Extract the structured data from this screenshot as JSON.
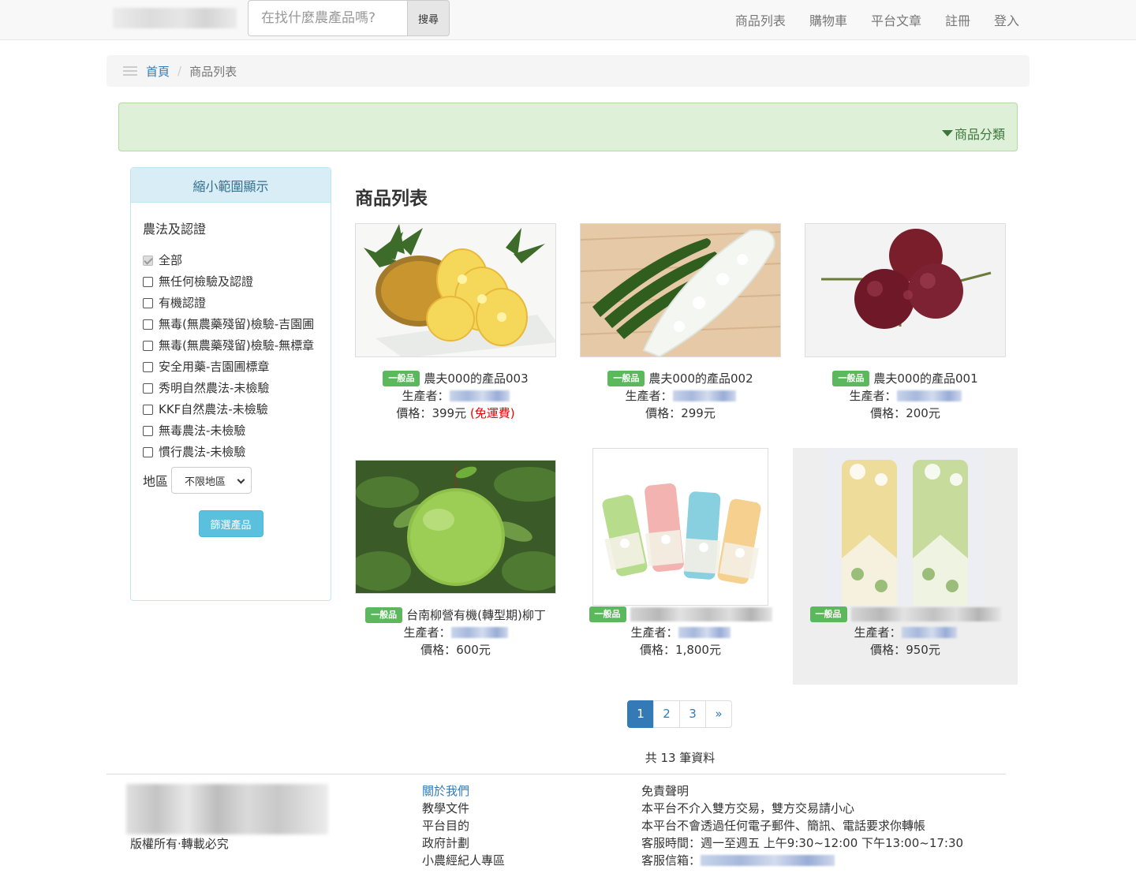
{
  "navbar": {
    "search_placeholder": "在找什麼農產品嗎?",
    "search_button": "搜尋",
    "links": [
      "商品列表",
      "購物車",
      "平台文章",
      "註冊",
      "登入"
    ]
  },
  "breadcrumb": {
    "home": "首頁",
    "separator": "/",
    "current": "商品列表"
  },
  "category_toggle": "商品分類",
  "filter": {
    "heading": "縮小範圍顯示",
    "section_title": "農法及認證",
    "options": [
      {
        "label": "全部",
        "checked": true
      },
      {
        "label": "無任何檢驗及認證",
        "checked": false
      },
      {
        "label": "有機認證",
        "checked": false
      },
      {
        "label": "無毒(無農藥殘留)檢驗-吉園圃",
        "checked": false
      },
      {
        "label": "無毒(無農藥殘留)檢驗-無標章",
        "checked": false
      },
      {
        "label": "安全用藥-吉園圃標章",
        "checked": false
      },
      {
        "label": "秀明自然農法-未檢驗",
        "checked": false
      },
      {
        "label": "KKF自然農法-未檢驗",
        "checked": false
      },
      {
        "label": "無毒農法-未檢驗",
        "checked": false
      },
      {
        "label": "慣行農法-未檢驗",
        "checked": false
      }
    ],
    "region_label": "地區",
    "region_value": "不限地區",
    "submit": "篩選產品"
  },
  "products_title": "商品列表",
  "products": [
    {
      "badge": "一般品",
      "name": "農夫000的產品003",
      "producer_label": "生產者：",
      "price_label": "價格：",
      "price": "399元",
      "shipping_note": "(免運費)"
    },
    {
      "badge": "一般品",
      "name": "農夫000的產品002",
      "producer_label": "生產者：",
      "price_label": "價格：",
      "price": "299元"
    },
    {
      "badge": "一般品",
      "name": "農夫000的產品001",
      "producer_label": "生產者：",
      "price_label": "價格：",
      "price": "200元"
    },
    {
      "badge": "一般品",
      "name": "台南柳營有機(轉型期)柳丁",
      "producer_label": "生產者：",
      "price_label": "價格：",
      "price": "600元"
    },
    {
      "badge": "一般品",
      "name": "",
      "producer_label": "生產者：",
      "price_label": "價格：",
      "price": "1,800元"
    },
    {
      "badge": "一般品",
      "name": "",
      "producer_label": "生產者：",
      "price_label": "價格：",
      "price": "950元"
    }
  ],
  "pagination": {
    "pages": [
      "1",
      "2",
      "3"
    ],
    "next": "»",
    "active": "1"
  },
  "total": "共 13 筆資料",
  "footer": {
    "copyright": "版權所有‧轉載必究",
    "links": [
      "關於我們",
      "教學文件",
      "平台目的",
      "政府計劃",
      "小農經紀人專區"
    ],
    "disclaimer_title": "免責聲明",
    "disclaimer_lines": [
      "本平台不介入雙方交易，雙方交易請小心",
      "本平台不會透過任何電子郵件、簡訊、電話要求你轉帳",
      "客服時間：週一至週五 上午9:30~12:00 下午13:00~17:30"
    ],
    "mail_label": "客服信箱："
  },
  "colors": {
    "link": "#337ab7",
    "badge": "#5cb85c",
    "category_bg": "#dff0d8",
    "filter_head_bg": "#d9edf7",
    "filter_button": "#5bc0de",
    "free_shipping": "#e00000"
  }
}
